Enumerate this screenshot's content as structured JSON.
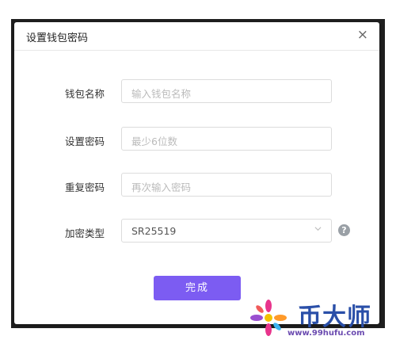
{
  "dialog": {
    "title": "设置钱包密码",
    "close_glyph": "×"
  },
  "form": {
    "wallet_name": {
      "label": "钱包名称",
      "placeholder": "输入钱包名称"
    },
    "password": {
      "label": "设置密码",
      "placeholder": "最少6位数"
    },
    "repeat_password": {
      "label": "重复密码",
      "placeholder": "再次输入密码"
    },
    "encryption_type": {
      "label": "加密类型",
      "value": "SR25519"
    },
    "help_glyph": "?"
  },
  "submit_label": "完成",
  "watermark": {
    "brand": "币大师",
    "url": "www.99hufu.com"
  },
  "colors": {
    "accent": "#7c5cf2",
    "frame": "#1f1f1f"
  }
}
